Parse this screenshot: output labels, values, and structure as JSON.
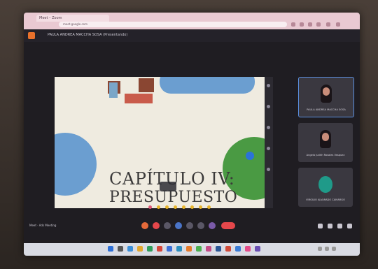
{
  "browser": {
    "tab_title": "Meet – Zoom",
    "url": "meet.google.com"
  },
  "meeting": {
    "title": "PAULA ANDREA MACCHA SOSA (Presentando)",
    "footer_text": "Meet · Ads Meeting"
  },
  "slide": {
    "title_line1": "CAPÍTULO IV:",
    "title_line2": "PRESUPUESTO"
  },
  "participants": [
    {
      "name": "PAULA ANDREA MACCHA SOSA"
    },
    {
      "name": "Angela Judith Rosales Vasquez"
    },
    {
      "name": "VIRGILIO ALVARADO CAMARGO"
    }
  ],
  "colors": {
    "accent_meet": "#e8712b",
    "end_call": "#e5474b",
    "slide_blue": "#6b9ed0",
    "slide_green": "#4a9a43"
  },
  "icons": {
    "reaction_heart": "heart-icon",
    "mic": "microphone-icon",
    "camera": "camera-icon",
    "end_call": "phone-hangup-icon"
  }
}
